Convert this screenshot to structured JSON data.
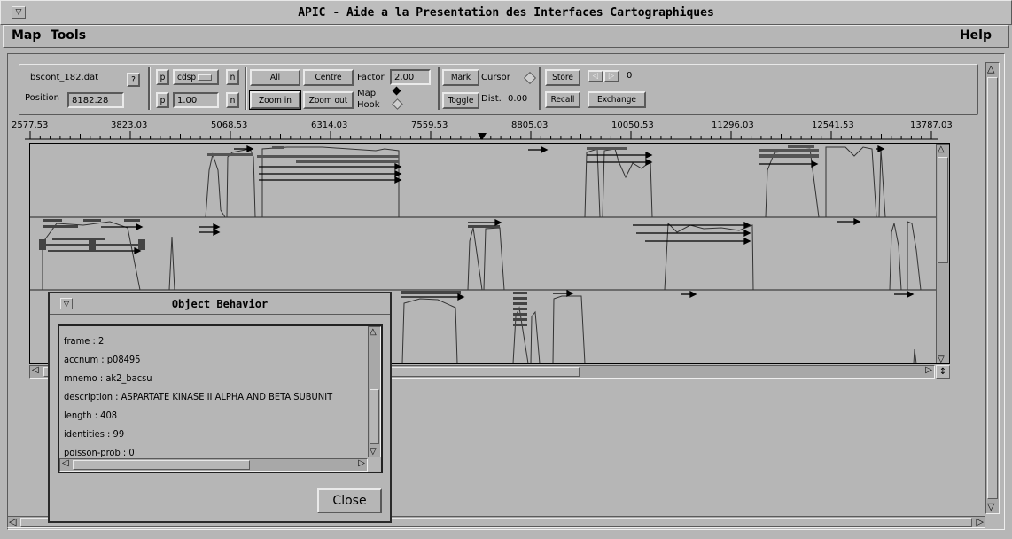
{
  "window": {
    "title": "APIC - Aide a la Presentation des Interfaces Cartographiques"
  },
  "menubar": {
    "items": [
      "Map",
      "Tools"
    ],
    "help": "Help"
  },
  "toolbar": {
    "filename": "bscont_182.dat",
    "question": "?",
    "position_label": "Position",
    "position_value": "8182.28",
    "p1": "p",
    "n1": "n",
    "p2": "p",
    "n2": "n",
    "track_select": "cdsp",
    "track_value": "1.00",
    "all_label": "All",
    "centre_label": "Centre",
    "factor_label": "Factor",
    "factor_value": "2.00",
    "zoom_in_label": "Zoom in",
    "zoom_out_label": "Zoom out",
    "map_label": "Map",
    "hook_label": "Hook",
    "mark_label": "Mark",
    "cursor_label": "Cursor",
    "toggle_label": "Toggle",
    "dist_label": "Dist.",
    "dist_value": "0.00",
    "store_label": "Store",
    "recall_label": "Recall",
    "exchange_label": "Exchange",
    "counter_value": "0"
  },
  "ruler": {
    "ticks": [
      "2577.53",
      "3823.03",
      "5068.53",
      "6314.03",
      "7559.53",
      "8805.03",
      "10050.53",
      "11296.03",
      "12541.53",
      "13787.03"
    ]
  },
  "dialog": {
    "title": "Object Behavior",
    "lines": [
      "frame : 2",
      "accnum : p08495",
      "mnemo : ak2_bacsu",
      "description : ASPARTATE KINASE II ALPHA AND BETA SUBUNIT",
      "length : 408",
      "identities : 99",
      "poisson-prob : 0"
    ],
    "close_label": "Close"
  }
}
